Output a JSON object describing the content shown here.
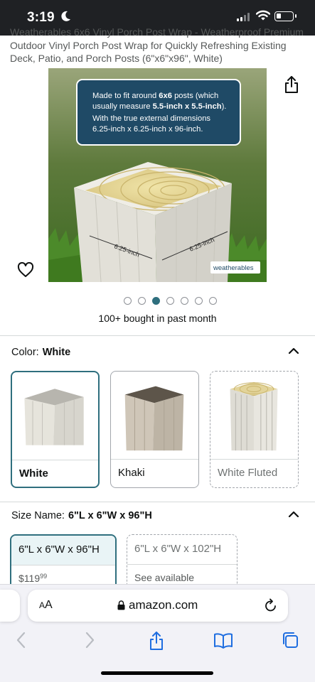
{
  "status_bar": {
    "time": "3:19"
  },
  "product": {
    "title": "Weatherables 6x6 Vinyl Porch Post Wrap - Weatherproof Premium Outdoor Vinyl Porch Post Wrap for Quickly Refreshing Existing Deck, Patio, and Porch Posts (6\"x6\"x96\", White)",
    "image": {
      "callout_line1_pre": "Made to fit around ",
      "callout_line1_bold": "6x6",
      "callout_line1_post": " posts (which",
      "callout_line2_pre": "usually measure ",
      "callout_line2_bold": "5.5-inch x 5.5-inch",
      "callout_line2_post": ").",
      "callout_line3": "With the true external dimensions",
      "callout_line4": "6.25-inch x 6.25-inch x 96-inch.",
      "dim_left": "6.25-inch",
      "dim_right": "6.25-inch",
      "brand": "weatherables"
    },
    "carousel": {
      "count": 7,
      "active_index": 2
    },
    "bought_text": "100+ bought in past month"
  },
  "color": {
    "label": "Color:",
    "selected_value": "White",
    "options": [
      {
        "label": "White",
        "state": "selected"
      },
      {
        "label": "Khaki",
        "state": "available"
      },
      {
        "label": "White Fluted",
        "state": "unavailable"
      }
    ]
  },
  "size": {
    "label": "Size Name:",
    "selected_value": "6\"L x 6\"W x 96\"H",
    "options": [
      {
        "label": "6\"L x 6\"W x 96\"H",
        "price_dollars": "$119",
        "price_cents": "99",
        "state": "selected"
      },
      {
        "label": "6\"L x 6\"W x 102\"H",
        "subtext": "See available",
        "state": "unavailable"
      }
    ]
  },
  "browser": {
    "text_size_big": "A",
    "text_size_small": "A",
    "domain": "amazon.com"
  },
  "colors": {
    "accent": "#2f6f7e",
    "callout_bg": "#1f4a66",
    "status_bar": "#1f2124"
  }
}
